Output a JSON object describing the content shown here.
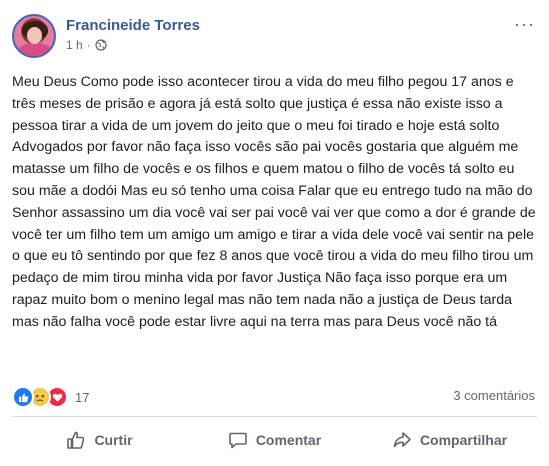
{
  "post": {
    "author": "Francineide Torres",
    "time": "1 h",
    "separator": "·",
    "privacy_icon": "globe-icon",
    "more_label": "···",
    "text": "Meu Deus Como pode isso acontecer tirou a vida do meu filho pegou 17 anos e três meses de prisão e agora já está solto que justiça é essa não existe isso a pessoa tirar a vida de um jovem do jeito que o meu foi tirado e hoje está solto Advogados por favor não faça isso vocês são pai vocês gostaria que alguém me matasse um filho de vocês e os filhos e quem matou o filho de vocês tá solto eu sou mãe a dodói Mas eu só tenho uma coisa Falar que eu entrego tudo na mão do Senhor assassino um dia você vai ser pai você vai ver que como a dor é grande de você ter um filho tem um amigo um amigo e tirar a vida dele você vai sentir na pele o que eu tô sentindo por que fez 8 anos que você tirou a vida do meu filho tirou um pedaço de mim tirou minha vida por favor Justiça Não faça isso porque era um rapaz muito bom o menino legal mas não tem nada não a justiça de Deus tarda mas não falha você pode estar livre aqui na terra mas para Deus você não tá"
  },
  "reactions": {
    "types": [
      "like-icon",
      "sad-icon",
      "love-icon"
    ],
    "count": "17",
    "comments": "3 comentários"
  },
  "actions": {
    "like": "Curtir",
    "comment": "Comentar",
    "share": "Compartilhar"
  },
  "colors": {
    "author": "#385898",
    "like": "#2078f4",
    "sad": "#f7c94b",
    "love": "#f0284a"
  }
}
